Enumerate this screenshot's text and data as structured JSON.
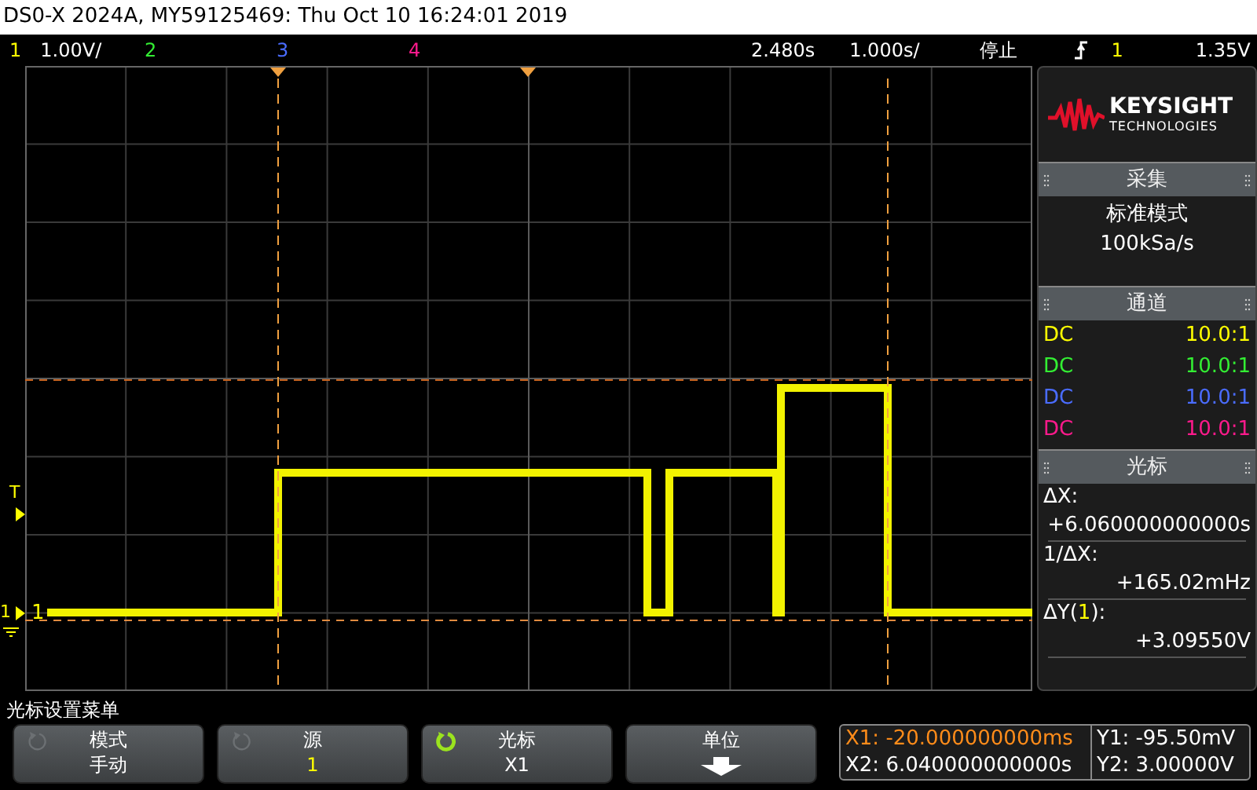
{
  "window": {
    "title": "DS0-X 2024A, MY59125469: Thu Oct 10 16:24:01 2019"
  },
  "top_bar": {
    "channels": [
      {
        "label": "1",
        "scale": "1.00V/",
        "color": "#ffff00"
      },
      {
        "label": "2",
        "color": "#33ee33"
      },
      {
        "label": "3",
        "color": "#4a6cff"
      },
      {
        "label": "4",
        "color": "#ff1a8c"
      }
    ],
    "time_position": "2.480s",
    "time_scale": "1.000s/",
    "run_state": "停止",
    "trigger_source": "1",
    "trigger_level": "1.35V"
  },
  "plot": {
    "trigger_marker": "T",
    "channel_marker": "1",
    "channel_label": "1"
  },
  "logo": {
    "brand": "KEYSIGHT",
    "subtitle": "TECHNOLOGIES"
  },
  "acquisition": {
    "title": "采集",
    "mode": "标准模式",
    "rate": "100kSa/s"
  },
  "channels_panel": {
    "title": "通道",
    "rows": [
      {
        "coupling": "DC",
        "probe": "10.0:1",
        "color": "#ffff00"
      },
      {
        "coupling": "DC",
        "probe": "10.0:1",
        "color": "#33ee33"
      },
      {
        "coupling": "DC",
        "probe": "10.0:1",
        "color": "#4a6cff"
      },
      {
        "coupling": "DC",
        "probe": "10.0:1",
        "color": "#ff1a8c"
      }
    ]
  },
  "cursors_panel": {
    "title": "光标",
    "items": [
      {
        "label": "ΔX:",
        "value": "+6.060000000000s"
      },
      {
        "label": "1/ΔX:",
        "value": "+165.02mHz"
      },
      {
        "label": "ΔY(",
        "source": "1",
        "label_end": "):",
        "value": "+3.09550V"
      }
    ]
  },
  "menu": {
    "title": "光标设置菜单",
    "softkeys": [
      {
        "kind": "knob",
        "label": "模式",
        "value": "手动",
        "active": false
      },
      {
        "kind": "knob",
        "label": "源",
        "value": "1",
        "active": false,
        "color": "#ffff00"
      },
      {
        "kind": "knob",
        "label": "光标",
        "value": "X1",
        "active": true
      },
      {
        "kind": "submenu",
        "label": "单位"
      }
    ]
  },
  "readout": {
    "left": [
      {
        "text": "X1: -20.000000000ms",
        "selected": true
      },
      {
        "text": "X2: 6.040000000000s",
        "selected": false
      }
    ],
    "right": [
      {
        "text": "Y1: -95.50mV",
        "selected": false
      },
      {
        "text": "Y2: 3.00000V",
        "selected": false
      }
    ]
  }
}
